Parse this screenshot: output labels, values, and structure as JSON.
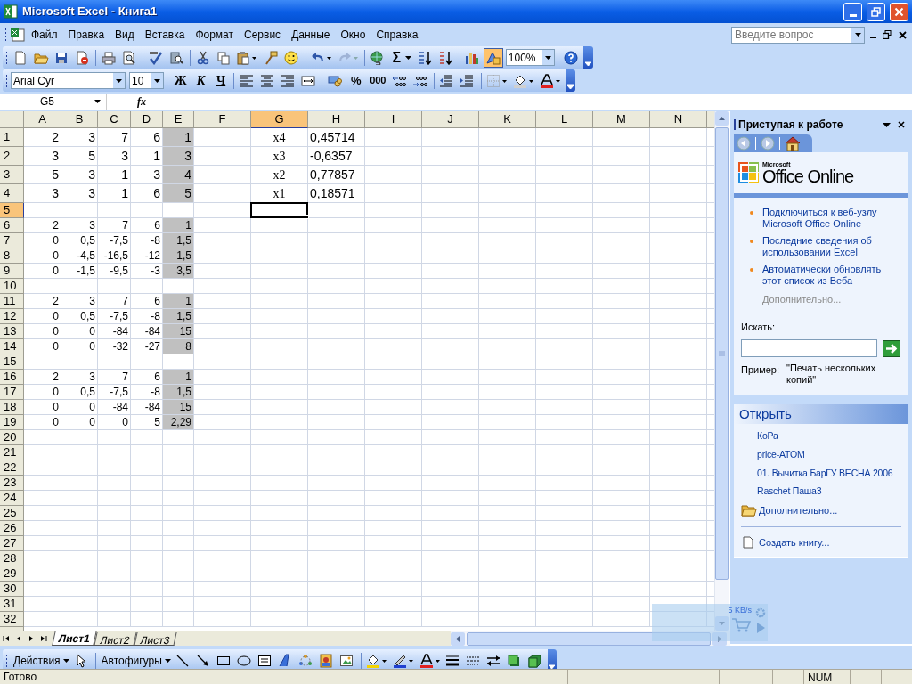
{
  "window": {
    "title": "Microsoft Excel - Книга1"
  },
  "menu": [
    "Файл",
    "Правка",
    "Вид",
    "Вставка",
    "Формат",
    "Сервис",
    "Данные",
    "Окно",
    "Справка"
  ],
  "help_box": {
    "placeholder": "Введите вопрос"
  },
  "standard_toolbar": {
    "sum": "Σ",
    "zoom": "100%",
    "drawing_on": true
  },
  "formatting_toolbar": {
    "font": "Arial Cyr",
    "size": "10",
    "bold": "Ж",
    "italic": "К",
    "underline": "Ч",
    "percent": "%",
    "thousands": "000"
  },
  "formula_bar": {
    "name_box": "G5",
    "fx": "fx"
  },
  "sheet": {
    "columns": [
      {
        "label": "A",
        "selected": false
      },
      {
        "label": "B",
        "selected": false
      },
      {
        "label": "C",
        "selected": false
      },
      {
        "label": "D",
        "selected": false
      },
      {
        "label": "E",
        "selected": false
      },
      {
        "label": "F",
        "selected": false
      },
      {
        "label": "G",
        "selected": true
      },
      {
        "label": "H",
        "selected": false
      },
      {
        "label": "I",
        "selected": false
      },
      {
        "label": "J",
        "selected": false
      },
      {
        "label": "K",
        "selected": false
      },
      {
        "label": "L",
        "selected": false
      },
      {
        "label": "M",
        "selected": false
      },
      {
        "label": "N",
        "selected": false
      }
    ],
    "rows": [
      {
        "label": "1",
        "selected": false,
        "cells": [
          {
            "text": "2",
            "shaded": false
          },
          {
            "text": "3",
            "shaded": false
          },
          {
            "text": "7",
            "shaded": false
          },
          {
            "text": "6",
            "shaded": false
          },
          {
            "text": "1",
            "shaded": true
          }
        ],
        "answer": {
          "name": "x4",
          "value": "0,45714"
        }
      },
      {
        "label": "2",
        "selected": false,
        "cells": [
          {
            "text": "3",
            "shaded": false
          },
          {
            "text": "5",
            "shaded": false
          },
          {
            "text": "3",
            "shaded": false
          },
          {
            "text": "1",
            "shaded": false
          },
          {
            "text": "3",
            "shaded": true
          }
        ],
        "answer": {
          "name": "x3",
          "value": "-0,6357"
        }
      },
      {
        "label": "3",
        "selected": false,
        "cells": [
          {
            "text": "5",
            "shaded": false
          },
          {
            "text": "3",
            "shaded": false
          },
          {
            "text": "1",
            "shaded": false
          },
          {
            "text": "3",
            "shaded": false
          },
          {
            "text": "4",
            "shaded": true
          }
        ],
        "answer": {
          "name": "x2",
          "value": "0,77857"
        }
      },
      {
        "label": "4",
        "selected": false,
        "cells": [
          {
            "text": "3",
            "shaded": false
          },
          {
            "text": "3",
            "shaded": false
          },
          {
            "text": "1",
            "shaded": false
          },
          {
            "text": "6",
            "shaded": false
          },
          {
            "text": "5",
            "shaded": true
          }
        ],
        "answer": {
          "name": "x1",
          "value": "0,18571"
        }
      },
      {
        "label": "5",
        "selected": true
      },
      {
        "label": "6",
        "selected": false,
        "cells": [
          {
            "text": "2",
            "shaded": false
          },
          {
            "text": "3",
            "shaded": false
          },
          {
            "text": "7",
            "shaded": false
          },
          {
            "text": "6",
            "shaded": false
          },
          {
            "text": "1",
            "shaded": true
          }
        ]
      },
      {
        "label": "7",
        "selected": false,
        "cells": [
          {
            "text": "0",
            "shaded": false
          },
          {
            "text": "0,5",
            "shaded": false
          },
          {
            "text": "-7,5",
            "shaded": false
          },
          {
            "text": "-8",
            "shaded": false
          },
          {
            "text": "1,5",
            "shaded": true
          }
        ]
      },
      {
        "label": "8",
        "selected": false,
        "cells": [
          {
            "text": "0",
            "shaded": false
          },
          {
            "text": "-4,5",
            "shaded": false
          },
          {
            "text": "-16,5",
            "shaded": false
          },
          {
            "text": "-12",
            "shaded": false
          },
          {
            "text": "1,5",
            "shaded": true
          }
        ]
      },
      {
        "label": "9",
        "selected": false,
        "cells": [
          {
            "text": "0",
            "shaded": false
          },
          {
            "text": "-1,5",
            "shaded": false
          },
          {
            "text": "-9,5",
            "shaded": false
          },
          {
            "text": "-3",
            "shaded": false
          },
          {
            "text": "3,5",
            "shaded": true
          }
        ]
      },
      {
        "label": "10",
        "selected": false
      },
      {
        "label": "11",
        "selected": false,
        "cells": [
          {
            "text": "2",
            "shaded": false
          },
          {
            "text": "3",
            "shaded": false
          },
          {
            "text": "7",
            "shaded": false
          },
          {
            "text": "6",
            "shaded": false
          },
          {
            "text": "1",
            "shaded": true
          }
        ]
      },
      {
        "label": "12",
        "selected": false,
        "cells": [
          {
            "text": "0",
            "shaded": false
          },
          {
            "text": "0,5",
            "shaded": false
          },
          {
            "text": "-7,5",
            "shaded": false
          },
          {
            "text": "-8",
            "shaded": false
          },
          {
            "text": "1,5",
            "shaded": true
          }
        ]
      },
      {
        "label": "13",
        "selected": false,
        "cells": [
          {
            "text": "0",
            "shaded": false
          },
          {
            "text": "0",
            "shaded": false
          },
          {
            "text": "-84",
            "shaded": false
          },
          {
            "text": "-84",
            "shaded": false
          },
          {
            "text": "15",
            "shaded": true
          }
        ]
      },
      {
        "label": "14",
        "selected": false,
        "cells": [
          {
            "text": "0",
            "shaded": false
          },
          {
            "text": "0",
            "shaded": false
          },
          {
            "text": "-32",
            "shaded": false
          },
          {
            "text": "-27",
            "shaded": false
          },
          {
            "text": "8",
            "shaded": true
          }
        ]
      },
      {
        "label": "15",
        "selected": false
      },
      {
        "label": "16",
        "selected": false,
        "cells": [
          {
            "text": "2",
            "shaded": false
          },
          {
            "text": "3",
            "shaded": false
          },
          {
            "text": "7",
            "shaded": false
          },
          {
            "text": "6",
            "shaded": false
          },
          {
            "text": "1",
            "shaded": true
          }
        ]
      },
      {
        "label": "17",
        "selected": false,
        "cells": [
          {
            "text": "0",
            "shaded": false
          },
          {
            "text": "0,5",
            "shaded": false
          },
          {
            "text": "-7,5",
            "shaded": false
          },
          {
            "text": "-8",
            "shaded": false
          },
          {
            "text": "1,5",
            "shaded": true
          }
        ]
      },
      {
        "label": "18",
        "selected": false,
        "cells": [
          {
            "text": "0",
            "shaded": false
          },
          {
            "text": "0",
            "shaded": false
          },
          {
            "text": "-84",
            "shaded": false
          },
          {
            "text": "-84",
            "shaded": false
          },
          {
            "text": "15",
            "shaded": true
          }
        ]
      },
      {
        "label": "19",
        "selected": false,
        "cells": [
          {
            "text": "0",
            "shaded": false
          },
          {
            "text": "0",
            "shaded": false
          },
          {
            "text": "0",
            "shaded": false
          },
          {
            "text": "5",
            "shaded": false
          },
          {
            "text": "2,29",
            "shaded": true
          }
        ]
      },
      {
        "label": "20",
        "selected": false
      },
      {
        "label": "21",
        "selected": false
      },
      {
        "label": "22",
        "selected": false
      },
      {
        "label": "23",
        "selected": false
      },
      {
        "label": "24",
        "selected": false
      },
      {
        "label": "25",
        "selected": false
      },
      {
        "label": "26",
        "selected": false
      },
      {
        "label": "27",
        "selected": false
      },
      {
        "label": "28",
        "selected": false
      },
      {
        "label": "29",
        "selected": false
      },
      {
        "label": "30",
        "selected": false
      },
      {
        "label": "31",
        "selected": false
      },
      {
        "label": "32",
        "selected": false
      }
    ]
  },
  "sheet_tabs": [
    {
      "label": "Лист1",
      "selected": true
    },
    {
      "label": "Лист2",
      "selected": false
    },
    {
      "label": "Лист3",
      "selected": false
    }
  ],
  "task_pane": {
    "title": "Приступая к работе",
    "logo_small": "Microsoft",
    "logo": "Office Online",
    "links": [
      "Подключиться к веб-узлу Microsoft Office Online",
      "Последние сведения об использовании Excel",
      "Автоматически обновлять этот список из Веба"
    ],
    "more": {
      "label": "Дополнительно...",
      "disabled": true
    },
    "search_label": "Искать:",
    "example_label": "Пример:",
    "example": "\"Печать нескольких копий\"",
    "open_title": "Открыть",
    "files": [
      "КоРа",
      "price-ATOM",
      "01. Вычитка БарГУ ВЕСНА 2006",
      "Raschet Паша3"
    ],
    "open_more": "Дополнительно...",
    "create": "Создать книгу..."
  },
  "drawing_toolbar": {
    "actions": "Действия",
    "autoshapes": "Автофигуры"
  },
  "status_bar": {
    "text": "Готово",
    "num": "NUM"
  },
  "speed_widget": {
    "text": "5 KB/s"
  }
}
